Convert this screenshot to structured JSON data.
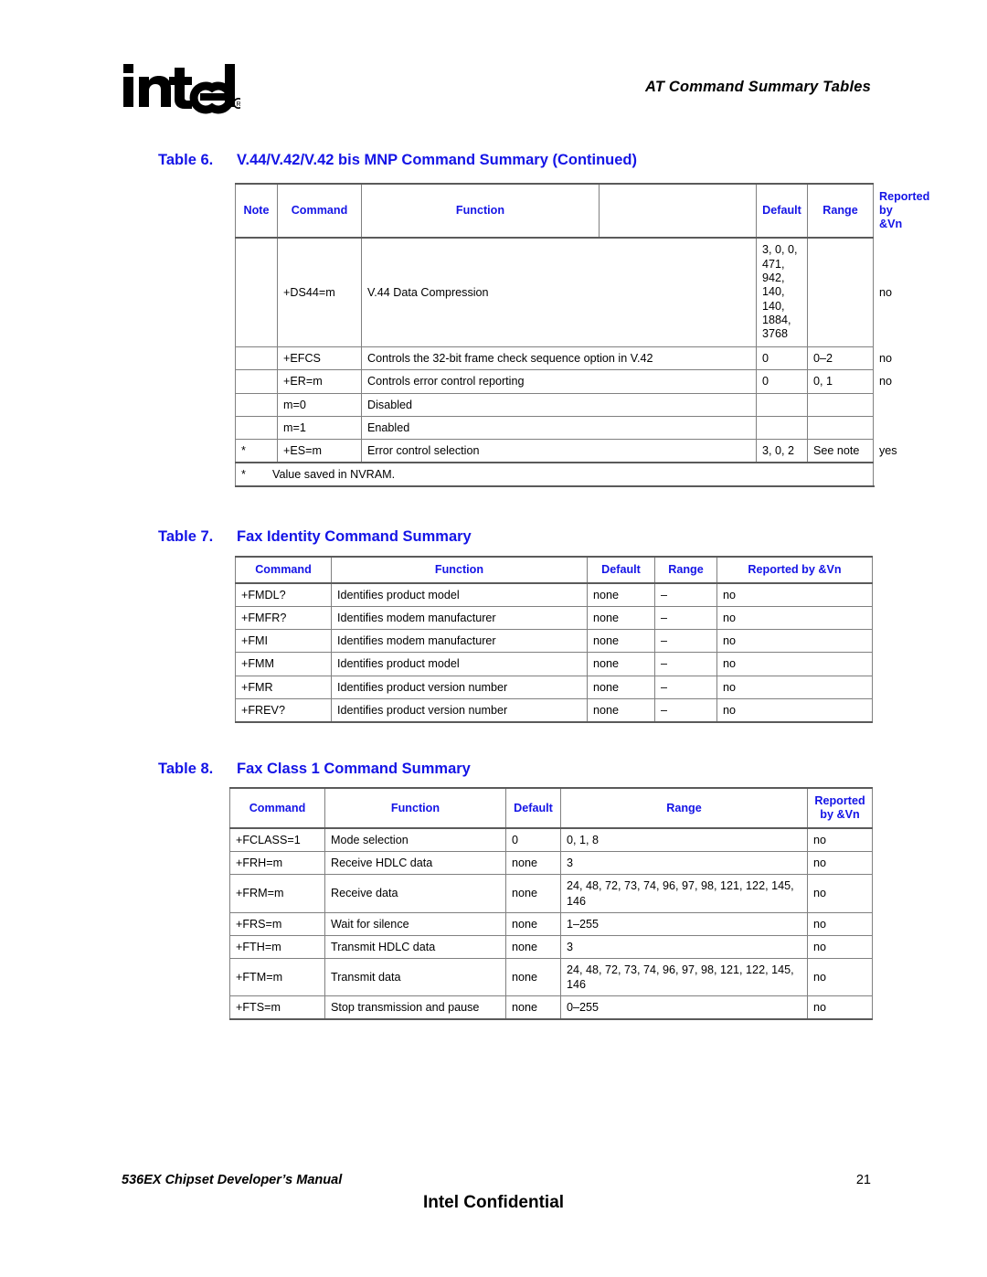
{
  "header": {
    "logo_alt": "intel",
    "title": "AT Command Summary Tables"
  },
  "table6": {
    "caption_number": "Table 6.",
    "caption_title": "V.44/V.42/V.42 bis MNP Command Summary (Continued)",
    "columns": [
      "Note",
      "Command",
      "Function",
      "",
      "Default",
      "Range",
      "Reported by &Vn"
    ],
    "columns_split": {
      "reported_line1": "Reported",
      "reported_line2": "by &Vn"
    },
    "rows": [
      {
        "note": "",
        "command": "+DS44=m",
        "function": "V.44 Data Compression",
        "default": "3, 0, 0,\n471,\n942,\n140,\n140,\n1884,\n3768",
        "range": "",
        "reported": "no"
      },
      {
        "note": "",
        "command": "+EFCS",
        "function": "Controls the 32-bit frame check sequence option in V.42",
        "default": "0",
        "range": "0–2",
        "reported": "no"
      },
      {
        "note": "",
        "command": "+ER=m",
        "function": "Controls error control reporting",
        "default": "0",
        "range": "0, 1",
        "reported": "no"
      },
      {
        "note": "",
        "command": "m=0",
        "function": "Disabled",
        "default": "",
        "range": "",
        "reported": ""
      },
      {
        "note": "",
        "command": "m=1",
        "function": "Enabled",
        "default": "",
        "range": "",
        "reported": ""
      },
      {
        "note": "*",
        "command": "+ES=m",
        "function": "Error control selection",
        "default": "3, 0, 2",
        "range": "See note",
        "reported": "yes"
      }
    ],
    "footnote_marker": "*",
    "footnote_text": "Value saved in NVRAM."
  },
  "table7": {
    "caption_number": "Table 7.",
    "caption_title": "Fax Identity Command Summary",
    "columns": [
      "Command",
      "Function",
      "Default",
      "Range",
      "Reported by &Vn"
    ],
    "rows": [
      {
        "command": "+FMDL?",
        "function": "Identifies product model",
        "default": "none",
        "range": "–",
        "reported": "no"
      },
      {
        "command": "+FMFR?",
        "function": "Identifies modem manufacturer",
        "default": "none",
        "range": "–",
        "reported": "no"
      },
      {
        "command": "+FMI",
        "function": "Identifies modem manufacturer",
        "default": "none",
        "range": "–",
        "reported": "no"
      },
      {
        "command": "+FMM",
        "function": "Identifies product model",
        "default": "none",
        "range": "–",
        "reported": "no"
      },
      {
        "command": "+FMR",
        "function": "Identifies product version number",
        "default": "none",
        "range": "–",
        "reported": "no"
      },
      {
        "command": "+FREV?",
        "function": "Identifies product version number",
        "default": "none",
        "range": "–",
        "reported": "no"
      }
    ]
  },
  "table8": {
    "caption_number": "Table 8.",
    "caption_title": "Fax Class 1 Command Summary",
    "columns": [
      "Command",
      "Function",
      "Default",
      "Range",
      "Reported by &Vn"
    ],
    "columns_split": {
      "reported_line1": "Reported",
      "reported_line2": "by &Vn"
    },
    "rows": [
      {
        "command": "+FCLASS=1",
        "function": "Mode selection",
        "default": "0",
        "range": "0, 1, 8",
        "reported": "no"
      },
      {
        "command": "+FRH=m",
        "function": "Receive HDLC data",
        "default": "none",
        "range": "3",
        "reported": "no"
      },
      {
        "command": "+FRM=m",
        "function": "Receive data",
        "default": "none",
        "range": "24, 48, 72, 73, 74, 96, 97, 98, 121, 122, 145, 146",
        "reported": "no"
      },
      {
        "command": "+FRS=m",
        "function": "Wait for silence",
        "default": "none",
        "range": "1–255",
        "reported": "no"
      },
      {
        "command": "+FTH=m",
        "function": "Transmit HDLC data",
        "default": "none",
        "range": "3",
        "reported": "no"
      },
      {
        "command": "+FTM=m",
        "function": "Transmit data",
        "default": "none",
        "range": "24, 48, 72, 73, 74, 96, 97, 98, 121, 122, 145, 146",
        "reported": "no"
      },
      {
        "command": "+FTS=m",
        "function": "Stop transmission and pause",
        "default": "none",
        "range": "0–255",
        "reported": "no"
      }
    ]
  },
  "footer": {
    "manual": "536EX Chipset Developer’s Manual",
    "page_number": "21",
    "confidential": "Intel Confidential"
  },
  "colors": {
    "heading_blue": "#1414e6",
    "rule_gray": "#808080",
    "text_black": "#000000"
  }
}
